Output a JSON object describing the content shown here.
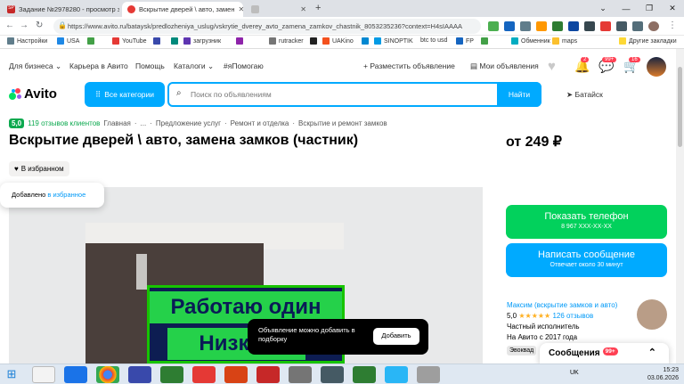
{
  "browser": {
    "tabs": [
      {
        "label": "Задание №2978280 - просмотр з",
        "favicon_color": "#c62828"
      },
      {
        "label": "Вскрытие дверей \\ авто, замен",
        "favicon_color": "#e53935"
      },
      {
        "label": "",
        "favicon_color": "#9e9e9e"
      }
    ],
    "url": "https://www.avito.ru/bataysk/predlozheniya_uslug/vskrytie_dverey_avto_zamena_zamkov_chastnik_8053235236?context=H4sIAAAA",
    "bookmarks": [
      "Настройки",
      "USA",
      "",
      "YouTube",
      "",
      "загрузник",
      "",
      "rutracker",
      "",
      "UAKino",
      "",
      "SINOPTIK",
      "btc to usd",
      "FP",
      "",
      "Обменник",
      "maps",
      "Другие закладки"
    ]
  },
  "site": {
    "topnav": {
      "business": "Для бизнеса",
      "career": "Карьера в Авито",
      "help": "Помощь",
      "catalogs": "Каталоги",
      "helping": "#яПомогаю",
      "post": "Разместить объявление",
      "my_ads": "Мои объявления",
      "badge_notifications": "2",
      "badge_messages": "99+",
      "badge_cart": "16"
    },
    "logo": "Avito",
    "categories_button": "Все категории",
    "search_placeholder": "Поиск по объявлениям",
    "search_button": "Найти",
    "city": "Батайск"
  },
  "listing": {
    "rating": "5,0",
    "reviews_link": "119 отзывов клиентов",
    "breadcrumbs": [
      "Главная",
      "...",
      "Предложение услуг",
      "Ремонт и отделка",
      "Вскрытие и ремонт замков"
    ],
    "title": "Вскрытие дверей \\ авто, замена замков (частник)",
    "price": "от 249 ₽",
    "favorite_button": "В избранном",
    "toast_added": "Добавлено ",
    "toast_link": "в избранное",
    "photo_text_line1": "Работаю один",
    "photo_text_line2": "Низкие",
    "tooltip_text": "Объявление можно добавить в подборку",
    "tooltip_button": "Добавить"
  },
  "sidebar": {
    "show_phone": "Показать телефон",
    "phone_masked": "8 967 XXX-XX-XX",
    "write_message": "Написать сообщение",
    "reply_time": "Отвечает около 30 минут",
    "seller_name": "Максим (вскрытие замков и авто)",
    "seller_rating": "5,0",
    "seller_stars": "★★★★★",
    "seller_reviews": "126 отзывов",
    "seller_type": "Частный исполнитель",
    "seller_since": "На Авито с 2017 года",
    "tag": "Эвоквад",
    "messages_label": "Сообщения",
    "messages_count": "99+"
  },
  "taskbar": {
    "lang": "UK",
    "time": "15:23",
    "date": "03.06.2026"
  }
}
